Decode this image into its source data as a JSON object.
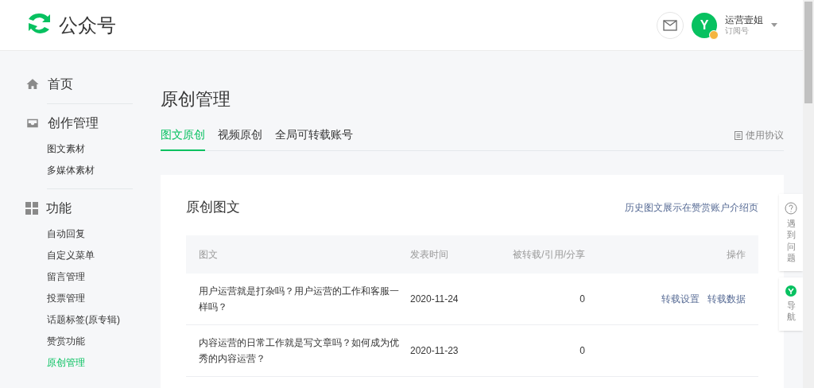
{
  "header": {
    "logo_text": "公众号",
    "user": {
      "name": "运营壹姐",
      "type": "订阅号",
      "avatar_letter": "Y"
    }
  },
  "sidebar": {
    "sections": [
      {
        "kind": "home",
        "title": "首页"
      },
      {
        "kind": "create",
        "title": "创作管理",
        "items": [
          {
            "label": "图文素材",
            "selected": false
          },
          {
            "label": "多媒体素材",
            "selected": false
          }
        ]
      },
      {
        "kind": "features",
        "title": "功能",
        "items": [
          {
            "label": "自动回复",
            "selected": false
          },
          {
            "label": "自定义菜单",
            "selected": false
          },
          {
            "label": "留言管理",
            "selected": false
          },
          {
            "label": "投票管理",
            "selected": false
          },
          {
            "label": "话题标签(原专辑)",
            "selected": false
          },
          {
            "label": "赞赏功能",
            "selected": false
          },
          {
            "label": "原创管理",
            "selected": true
          }
        ]
      }
    ]
  },
  "page": {
    "title": "原创管理",
    "tabs": [
      {
        "label": "图文原创",
        "selected": true
      },
      {
        "label": "视频原创",
        "selected": false
      },
      {
        "label": "全局可转载账号",
        "selected": false
      }
    ],
    "agreement_link": "使用协议"
  },
  "card": {
    "title": "原创图文",
    "link": "历史图文展示在赞赏账户介绍页",
    "table": {
      "columns": [
        "图文",
        "发表时间",
        "被转载/引用/分享",
        "操作"
      ],
      "rows": [
        {
          "title": "用户运营就是打杂吗？用户运营的工作和客服一样吗？",
          "date": "2020-11-24",
          "count": "0",
          "actions": [
            "转载设置",
            "转载数据"
          ]
        },
        {
          "title": "内容运营的日常工作就是写文章吗？如何成为优秀的内容运营？",
          "date": "2020-11-23",
          "count": "0",
          "actions": []
        }
      ]
    }
  },
  "float_panel": [
    {
      "kind": "help",
      "label": "遇到问题"
    },
    {
      "kind": "nav",
      "label": "导航"
    }
  ]
}
